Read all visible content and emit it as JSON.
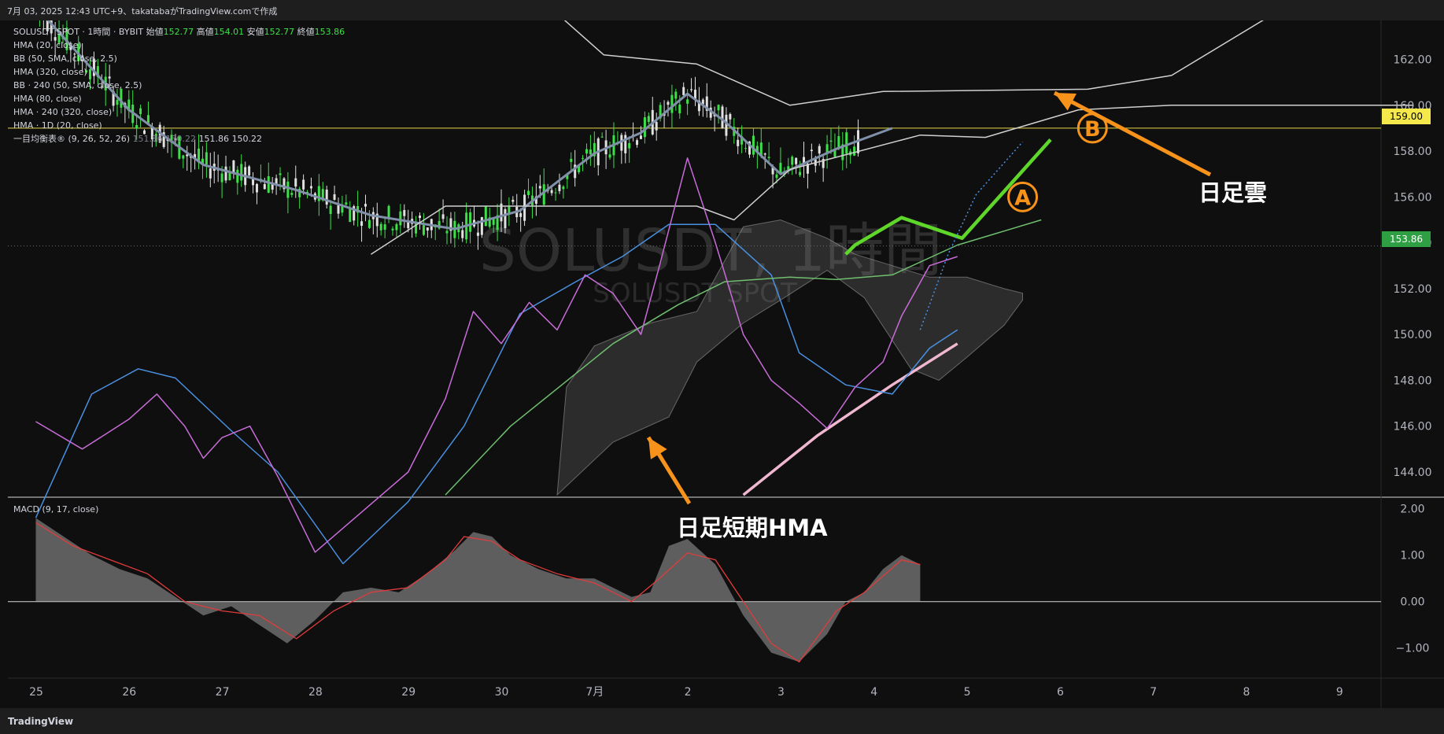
{
  "header": {
    "text": "7月 03, 2025 12:43 UTC+9、takatabaがTradingView.comで作成"
  },
  "legend": {
    "symbol": "SOLUSDT SPOT · 1時間 · BYBIT",
    "open_label": "始値",
    "open": "152.77",
    "high_label": "高値",
    "high": "154.01",
    "low_label": "安値",
    "low": "152.77",
    "close_label": "終値",
    "close": "153.86",
    "lines": [
      "HMA (20, close)",
      "BB (50, SMA, close, 2.5)",
      "HMA (320, close)",
      "BB · 240 (50, SMA, close, 2.5)",
      "HMA (80, close)",
      "HMA · 240 (320, close)",
      "HMA · 1D (20, close)"
    ],
    "ichimoku": "一目均衡表® (9, 26, 52, 26)",
    "ichimoku_vals": [
      "151.86",
      "150.22",
      "151.86",
      "150.22"
    ]
  },
  "macd_legend": "MACD (9, 17, close)",
  "watermark": {
    "main": "SOLUSDT, 1時間",
    "sub": "SOLUSDT SPOT"
  },
  "annotations": {
    "cloud": "日足雲",
    "hma": "日足短期HMA",
    "label_a": "A",
    "label_b": "B"
  },
  "price_tags": {
    "level": "159.00",
    "last": "153.86"
  },
  "footer": {
    "logo": "TradingView"
  },
  "colors": {
    "bull": "#3ee04a",
    "bear": "#e0e0e0",
    "hma20": "#c86cd8",
    "hma80": "#4a90e0",
    "bb": "#d0d0d0",
    "hma320": "#6fbf6f",
    "hma1d": "#f0b8d0",
    "hma240": "#8090a8",
    "arrow": "#f7931a",
    "plan": "#5fd62a"
  },
  "chart_data": [
    {
      "type": "line",
      "title": "",
      "x_ticks": [
        "25",
        "26",
        "27",
        "28",
        "29",
        "30",
        "7月",
        "2",
        "3",
        "4",
        "5",
        "6",
        "7",
        "8",
        "9"
      ],
      "y_ticks": [
        "162.00",
        "160.00",
        "158.00",
        "156.00",
        "154.00",
        "152.00",
        "150.00",
        "148.00",
        "146.00",
        "144.00"
      ],
      "ylim": [
        142.9,
        163.7
      ],
      "series": [
        {
          "name": "HMA · 1D (20, close)",
          "points": [
            [
              7.6,
              143.0
            ],
            [
              8.4,
              145.6
            ],
            [
              9.2,
              147.8
            ],
            [
              9.9,
              149.6
            ]
          ]
        },
        {
          "name": "HMA · 240 (320, close)",
          "points": [
            [
              0,
              164.3
            ],
            [
              1.0,
              159.8
            ],
            [
              1.8,
              157.4
            ],
            [
              2.8,
              156.3
            ],
            [
              3.6,
              155.2
            ],
            [
              4.5,
              154.6
            ],
            [
              5.2,
              155.4
            ],
            [
              6.0,
              157.9
            ],
            [
              6.5,
              158.8
            ],
            [
              7.0,
              160.5
            ],
            [
              7.4,
              159.3
            ],
            [
              8.0,
              157.0
            ],
            [
              8.6,
              158.1
            ],
            [
              9.2,
              159.0
            ]
          ]
        },
        {
          "name": "BB · 240 upper",
          "points": [
            [
              5.6,
              164.0
            ],
            [
              6.1,
              162.2
            ],
            [
              7.1,
              161.8
            ],
            [
              8.1,
              160.0
            ],
            [
              9.1,
              160.6
            ],
            [
              11.3,
              160.7
            ],
            [
              12.2,
              161.3
            ],
            [
              13.3,
              164.0
            ]
          ]
        },
        {
          "name": "BB · 240 lower",
          "points": [
            [
              3.6,
              153.5
            ],
            [
              4.4,
              155.6
            ],
            [
              7.1,
              155.6
            ],
            [
              7.5,
              155.0
            ],
            [
              8.1,
              157.2
            ],
            [
              9.5,
              158.7
            ],
            [
              10.2,
              158.6
            ],
            [
              11.2,
              159.8
            ],
            [
              12.2,
              160.0
            ],
            [
              14.8,
              160.0
            ]
          ]
        },
        {
          "name": "HMA (80, close)",
          "points": [
            [
              0,
              142.0
            ],
            [
              0.6,
              147.4
            ],
            [
              1.1,
              148.5
            ],
            [
              1.5,
              148.1
            ],
            [
              2.1,
              145.8
            ],
            [
              2.6,
              144.0
            ],
            [
              3.3,
              140.0
            ],
            [
              4.0,
              142.7
            ],
            [
              4.6,
              146.0
            ],
            [
              5.2,
              150.9
            ],
            [
              5.8,
              152.3
            ],
            [
              6.3,
              153.4
            ],
            [
              6.8,
              154.8
            ],
            [
              7.3,
              154.8
            ],
            [
              7.9,
              152.6
            ],
            [
              8.2,
              149.2
            ],
            [
              8.7,
              147.8
            ],
            [
              9.2,
              147.4
            ],
            [
              9.6,
              149.4
            ],
            [
              9.9,
              150.2
            ]
          ]
        },
        {
          "name": "HMA (320, close)",
          "points": [
            [
              4.4,
              143.0
            ],
            [
              5.1,
              146.0
            ],
            [
              6.2,
              149.6
            ],
            [
              6.9,
              151.3
            ],
            [
              7.4,
              152.3
            ],
            [
              8.1,
              152.5
            ],
            [
              8.6,
              152.4
            ],
            [
              9.2,
              152.6
            ],
            [
              9.9,
              153.9
            ],
            [
              10.8,
              155.0
            ]
          ]
        },
        {
          "name": "HMA (20, close)",
          "points": [
            [
              0,
              146.2
            ],
            [
              0.5,
              145.0
            ],
            [
              1.0,
              146.3
            ],
            [
              1.3,
              147.4
            ],
            [
              1.6,
              146.0
            ],
            [
              1.8,
              144.6
            ],
            [
              2.0,
              145.5
            ],
            [
              2.3,
              146.0
            ],
            [
              2.6,
              143.8
            ],
            [
              3.0,
              140.5
            ],
            [
              4.0,
              144.0
            ],
            [
              4.4,
              147.2
            ],
            [
              4.7,
              151.0
            ],
            [
              5.0,
              149.6
            ],
            [
              5.3,
              151.4
            ],
            [
              5.6,
              150.2
            ],
            [
              5.9,
              152.6
            ],
            [
              6.2,
              151.8
            ],
            [
              6.5,
              150.0
            ],
            [
              6.7,
              153.0
            ],
            [
              7.0,
              157.7
            ],
            [
              7.3,
              154.0
            ],
            [
              7.6,
              150.0
            ],
            [
              7.9,
              148.0
            ],
            [
              8.2,
              147.0
            ],
            [
              8.5,
              145.9
            ],
            [
              8.8,
              147.7
            ],
            [
              9.1,
              148.8
            ],
            [
              9.3,
              150.8
            ],
            [
              9.6,
              153.0
            ],
            [
              9.9,
              153.4
            ]
          ]
        },
        {
          "name": "plan",
          "points": [
            [
              8.7,
              153.5
            ],
            [
              8.8,
              153.9
            ],
            [
              9.3,
              155.1
            ],
            [
              9.95,
              154.2
            ],
            [
              10.9,
              158.5
            ]
          ]
        }
      ],
      "ichimoku_cloud": {
        "upper": [
          [
            5.7,
            147.7
          ],
          [
            6.0,
            149.5
          ],
          [
            6.6,
            150.5
          ],
          [
            7.1,
            151.0
          ],
          [
            7.6,
            154.7
          ],
          [
            8.0,
            155.0
          ],
          [
            8.5,
            154.2
          ],
          [
            8.8,
            153.5
          ],
          [
            9.2,
            153.0
          ],
          [
            9.6,
            152.5
          ],
          [
            10.0,
            152.5
          ],
          [
            10.4,
            152.0
          ],
          [
            10.6,
            151.8
          ]
        ],
        "lower": [
          [
            5.6,
            143.0
          ],
          [
            6.2,
            145.3
          ],
          [
            6.8,
            146.4
          ],
          [
            7.1,
            148.8
          ],
          [
            7.6,
            150.5
          ],
          [
            8.0,
            151.5
          ],
          [
            8.5,
            152.8
          ],
          [
            8.9,
            151.6
          ],
          [
            9.4,
            148.5
          ],
          [
            9.7,
            148.0
          ],
          [
            10.0,
            149.0
          ],
          [
            10.4,
            150.4
          ],
          [
            10.6,
            151.5
          ]
        ]
      },
      "level": 159.0,
      "last": 153.86
    },
    {
      "type": "area",
      "title": "MACD (9, 17, close)",
      "y_ticks": [
        "2.00",
        "1.00",
        "0.00",
        "−1.00"
      ],
      "ylim": [
        -1.65,
        2.25
      ],
      "histogram": [
        [
          0,
          1.8
        ],
        [
          0.3,
          1.4
        ],
        [
          0.6,
          1.0
        ],
        [
          0.9,
          0.7
        ],
        [
          1.2,
          0.5
        ],
        [
          1.5,
          0.1
        ],
        [
          1.8,
          -0.3
        ],
        [
          2.1,
          -0.1
        ],
        [
          2.4,
          -0.5
        ],
        [
          2.7,
          -0.9
        ],
        [
          3.0,
          -0.4
        ],
        [
          3.3,
          0.2
        ],
        [
          3.6,
          0.3
        ],
        [
          3.9,
          0.2
        ],
        [
          4.2,
          0.6
        ],
        [
          4.5,
          1.1
        ],
        [
          4.7,
          1.5
        ],
        [
          4.9,
          1.4
        ],
        [
          5.1,
          1.0
        ],
        [
          5.4,
          0.7
        ],
        [
          5.7,
          0.5
        ],
        [
          6.0,
          0.5
        ],
        [
          6.2,
          0.3
        ],
        [
          6.4,
          0.1
        ],
        [
          6.6,
          0.2
        ],
        [
          6.8,
          1.2
        ],
        [
          7.0,
          1.35
        ],
        [
          7.3,
          0.8
        ],
        [
          7.6,
          -0.3
        ],
        [
          7.9,
          -1.1
        ],
        [
          8.2,
          -1.3
        ],
        [
          8.5,
          -0.7
        ],
        [
          8.7,
          0.0
        ],
        [
          8.9,
          0.2
        ],
        [
          9.1,
          0.7
        ],
        [
          9.3,
          1.0
        ],
        [
          9.5,
          0.8
        ]
      ],
      "signal": [
        [
          0,
          1.7
        ],
        [
          0.4,
          1.2
        ],
        [
          0.8,
          0.9
        ],
        [
          1.2,
          0.6
        ],
        [
          1.6,
          0.0
        ],
        [
          2.0,
          -0.2
        ],
        [
          2.4,
          -0.3
        ],
        [
          2.8,
          -0.8
        ],
        [
          3.2,
          -0.2
        ],
        [
          3.6,
          0.2
        ],
        [
          4.0,
          0.3
        ],
        [
          4.4,
          0.9
        ],
        [
          4.6,
          1.4
        ],
        [
          4.9,
          1.3
        ],
        [
          5.2,
          0.9
        ],
        [
          5.6,
          0.6
        ],
        [
          6.0,
          0.4
        ],
        [
          6.4,
          0.0
        ],
        [
          6.7,
          0.5
        ],
        [
          7.0,
          1.05
        ],
        [
          7.3,
          0.9
        ],
        [
          7.6,
          0.0
        ],
        [
          7.9,
          -0.9
        ],
        [
          8.2,
          -1.3
        ],
        [
          8.6,
          -0.2
        ],
        [
          8.9,
          0.2
        ],
        [
          9.3,
          0.9
        ],
        [
          9.5,
          0.8
        ]
      ]
    }
  ]
}
